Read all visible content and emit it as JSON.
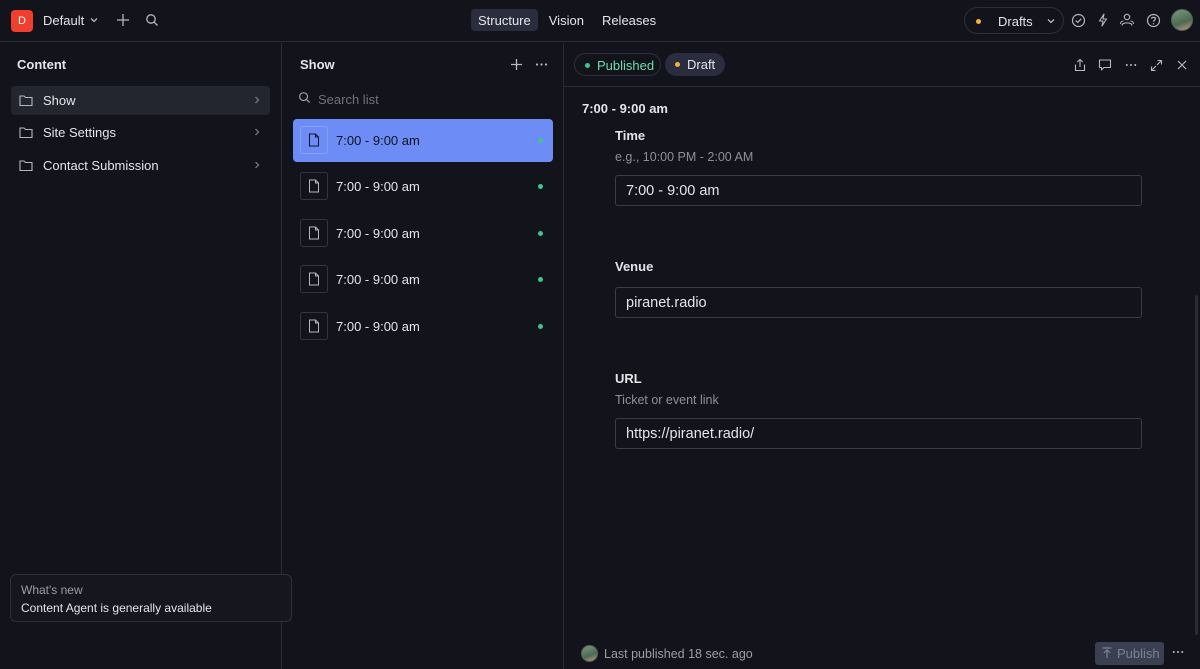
{
  "workspace": {
    "initial": "D",
    "name": "Default"
  },
  "nav": {
    "tabs": [
      {
        "label": "Structure",
        "active": true
      },
      {
        "label": "Vision"
      },
      {
        "label": "Releases"
      }
    ]
  },
  "perspective": {
    "label": "Drafts"
  },
  "content_pane": {
    "title": "Content",
    "items": [
      {
        "label": "Show",
        "selected": true
      },
      {
        "label": "Site Settings"
      },
      {
        "label": "Contact Submission"
      }
    ]
  },
  "whats_new": {
    "title": "What's new",
    "text": "Content Agent is generally available"
  },
  "list_pane": {
    "title": "Show",
    "search_placeholder": "Search list",
    "items": [
      {
        "title": "7:00 - 9:00 am",
        "selected": true
      },
      {
        "title": "7:00 - 9:00 am"
      },
      {
        "title": "7:00 - 9:00 am"
      },
      {
        "title": "7:00 - 9:00 am"
      },
      {
        "title": "7:00 - 9:00 am"
      }
    ]
  },
  "document": {
    "status_published": "Published",
    "status_draft": "Draft",
    "heading": "7:00 - 9:00 am",
    "fields": {
      "time": {
        "label": "Time",
        "description": "e.g., 10:00 PM - 2:00 AM",
        "value": "7:00 - 9:00 am"
      },
      "venue": {
        "label": "Venue",
        "value": "piranet.radio"
      },
      "url": {
        "label": "URL",
        "description": "Ticket or event link",
        "value": "https://piranet.radio/"
      }
    },
    "footer_status": "Last published 18 sec. ago",
    "publish_label": "Publish"
  },
  "colors": {
    "accent": "#6e8cf5",
    "published": "#3fc48e",
    "draft": "#f2b13a",
    "logo": "#f03e2f",
    "background": "#13141b"
  },
  "icons": [
    "chevron-down-icon",
    "plus-icon",
    "search-icon",
    "check-circle-icon",
    "bolt-icon",
    "users-icon",
    "help-icon",
    "folder-icon",
    "chevron-right-icon",
    "more-icon",
    "document-icon",
    "share-icon",
    "comment-icon",
    "expand-icon",
    "close-icon",
    "publish-icon"
  ]
}
